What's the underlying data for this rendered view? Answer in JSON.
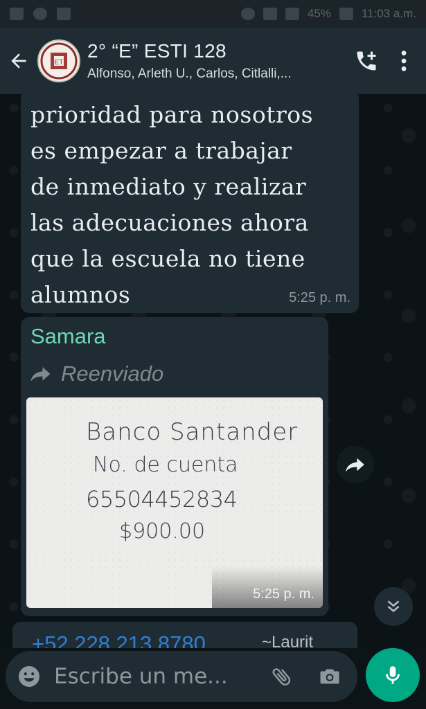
{
  "statusbar": {
    "battery": "45%",
    "time": "11:03 a.m.",
    "icons": [
      "facebook-icon",
      "cloud-icon",
      "message-icon",
      "alarm-icon",
      "wifi-icon",
      "signal-icon",
      "battery-icon"
    ]
  },
  "header": {
    "title": "2° “E” ESTI 128",
    "members": "Alfonso, Arleth U., Carlos, Citlalli,...",
    "icons": [
      "back-arrow-icon",
      "group-avatar",
      "add-call-icon",
      "more-vert-icon"
    ]
  },
  "messages": [
    {
      "lines": [
        "prioridad para nosotros",
        "es empezar a trabajar",
        "de inmediato y realizar",
        "las adecuaciones ahora",
        "que la escuela no tiene",
        "alumnos"
      ],
      "time": "5:25 p. m."
    },
    {
      "sender": "Samara",
      "forwarded_label": "Reenviado",
      "image_text": [
        "Banco Santander",
        "No. de cuenta",
        "65504452834",
        "$900.00"
      ],
      "time": "5:25 p. m."
    },
    {
      "sender_phone": "+52 228 213 8780",
      "sender_name": "~Laurit"
    }
  ],
  "input": {
    "placeholder": "Escribe un me...",
    "icons": [
      "emoji-icon",
      "attach-icon",
      "camera-icon",
      "mic-icon"
    ]
  },
  "colors": {
    "header_bg": "#1f2c33",
    "bubble_bg": "#1f2c33",
    "accent_green": "#00a884",
    "sender_color": "#6fd6b5"
  }
}
